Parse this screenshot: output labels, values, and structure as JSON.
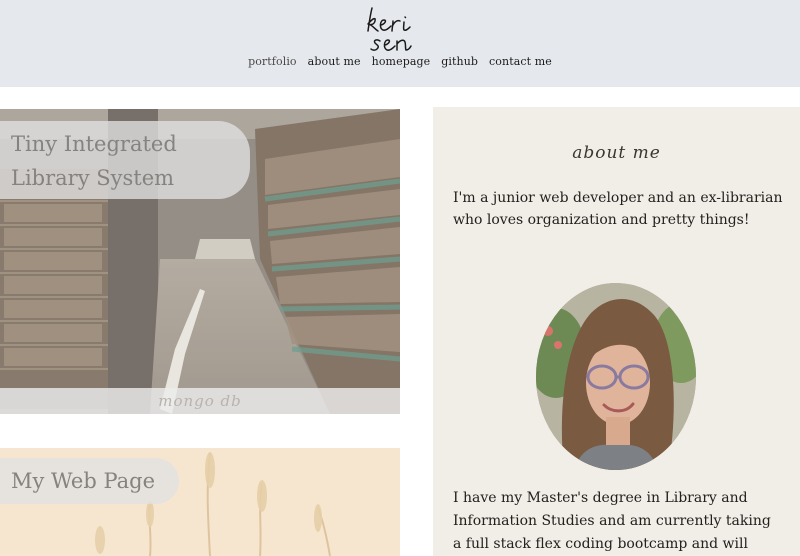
{
  "header": {
    "logo_text": "keri sen",
    "nav": [
      {
        "label": "portfolio"
      },
      {
        "label": "about me"
      },
      {
        "label": "homepage"
      },
      {
        "label": "github"
      },
      {
        "label": "contact me"
      }
    ]
  },
  "projects": [
    {
      "title": "Tiny Integrated Library System",
      "caption": "mongo db"
    },
    {
      "title": "My Web Page"
    }
  ],
  "about": {
    "heading": "about me",
    "intro": "I'm a junior web developer and an ex-librarian who loves organization and pretty things!",
    "bio": "I have my Master's degree in Library and Information Studies and am currently taking a full stack flex coding bootcamp and will"
  },
  "colors": {
    "header_bg": "#e5e9ee",
    "about_bg": "#f1ede7"
  }
}
